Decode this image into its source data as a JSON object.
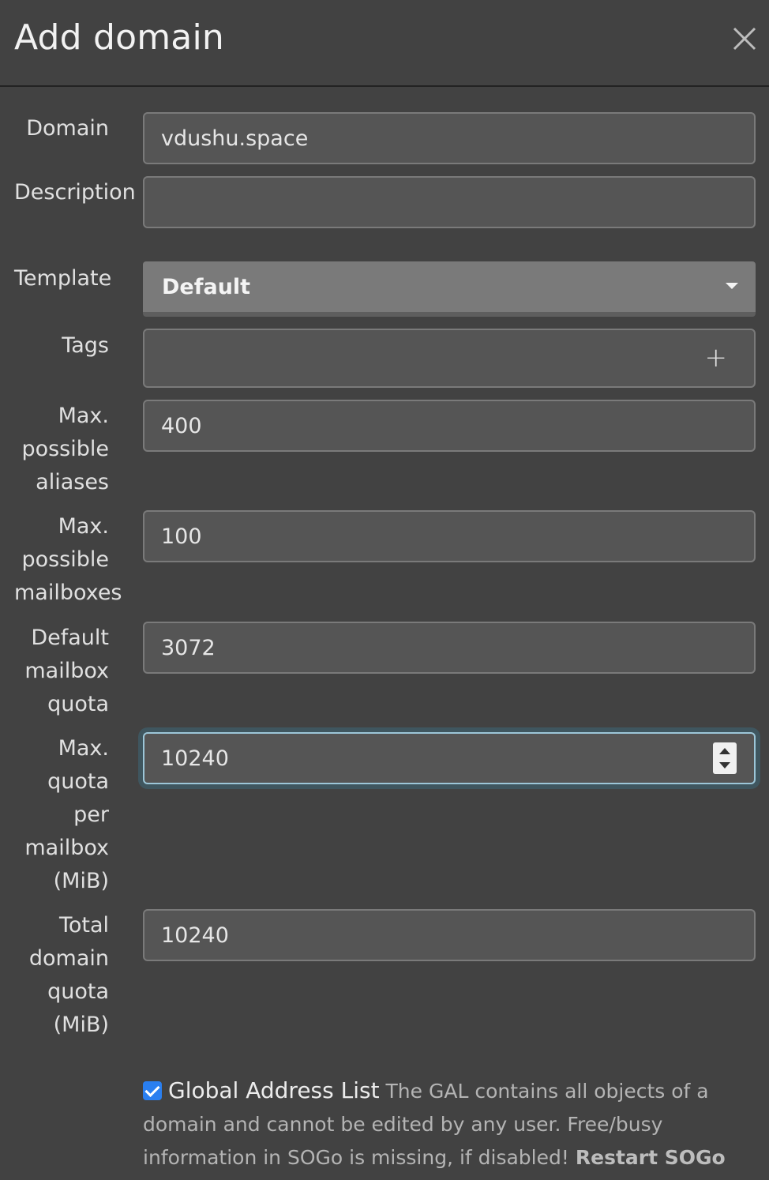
{
  "header": {
    "title": "Add domain"
  },
  "form": {
    "domain": {
      "label": "Domain",
      "value": "vdushu.space"
    },
    "description": {
      "label": "Description",
      "value": ""
    },
    "template": {
      "label": "Template",
      "value": "Default"
    },
    "tags": {
      "label": "Tags",
      "value": ""
    },
    "max_aliases": {
      "label_lines": [
        "Max.",
        "possible",
        "aliases"
      ],
      "value": "400"
    },
    "max_mailboxes": {
      "label_lines": [
        "Max.",
        "possible",
        "mailboxes"
      ],
      "value": "100"
    },
    "default_quota": {
      "label_lines": [
        "Default",
        "mailbox",
        "quota"
      ],
      "value": "3072"
    },
    "max_quota": {
      "label_lines": [
        "Max.",
        "quota",
        "per",
        "mailbox",
        "(MiB)"
      ],
      "value": "10240"
    },
    "total_quota": {
      "label_lines": [
        "Total",
        "domain",
        "quota",
        "(MiB)"
      ],
      "value": "10240"
    }
  },
  "gal": {
    "title": "Global Address List",
    "description": "The GAL contains all objects of a domain and cannot be edited by any user. Free/busy information in SOGo is missing, if disabled!",
    "restart": "Restart SOGo to apply changes.",
    "checked": true
  },
  "colors": {
    "background": "#424242",
    "input_bg": "#555555",
    "checkbox": "#2a7ff0"
  }
}
